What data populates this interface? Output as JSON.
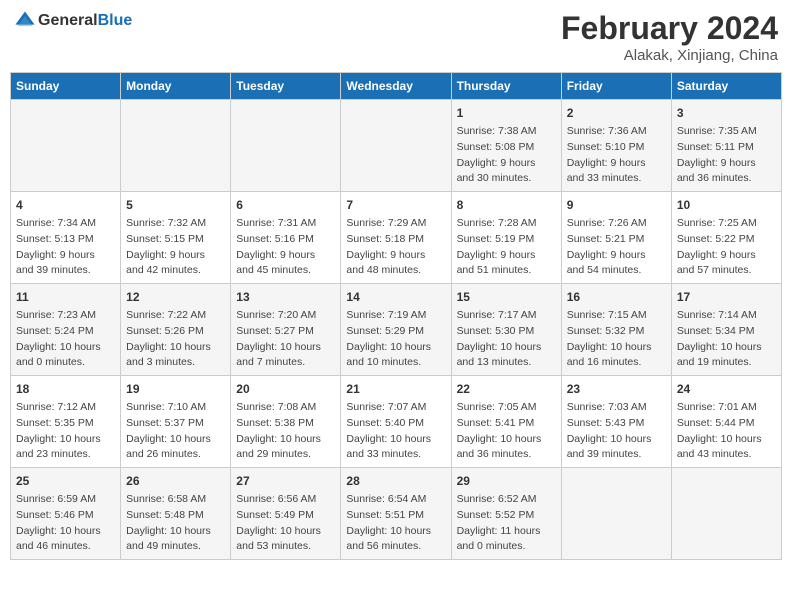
{
  "header": {
    "logo_line1": "General",
    "logo_line2": "Blue",
    "month_year": "February 2024",
    "location": "Alakak, Xinjiang, China"
  },
  "days_of_week": [
    "Sunday",
    "Monday",
    "Tuesday",
    "Wednesday",
    "Thursday",
    "Friday",
    "Saturday"
  ],
  "weeks": [
    [
      {
        "day": "",
        "info": ""
      },
      {
        "day": "",
        "info": ""
      },
      {
        "day": "",
        "info": ""
      },
      {
        "day": "",
        "info": ""
      },
      {
        "day": "1",
        "info": "Sunrise: 7:38 AM\nSunset: 5:08 PM\nDaylight: 9 hours\nand 30 minutes."
      },
      {
        "day": "2",
        "info": "Sunrise: 7:36 AM\nSunset: 5:10 PM\nDaylight: 9 hours\nand 33 minutes."
      },
      {
        "day": "3",
        "info": "Sunrise: 7:35 AM\nSunset: 5:11 PM\nDaylight: 9 hours\nand 36 minutes."
      }
    ],
    [
      {
        "day": "4",
        "info": "Sunrise: 7:34 AM\nSunset: 5:13 PM\nDaylight: 9 hours\nand 39 minutes."
      },
      {
        "day": "5",
        "info": "Sunrise: 7:32 AM\nSunset: 5:15 PM\nDaylight: 9 hours\nand 42 minutes."
      },
      {
        "day": "6",
        "info": "Sunrise: 7:31 AM\nSunset: 5:16 PM\nDaylight: 9 hours\nand 45 minutes."
      },
      {
        "day": "7",
        "info": "Sunrise: 7:29 AM\nSunset: 5:18 PM\nDaylight: 9 hours\nand 48 minutes."
      },
      {
        "day": "8",
        "info": "Sunrise: 7:28 AM\nSunset: 5:19 PM\nDaylight: 9 hours\nand 51 minutes."
      },
      {
        "day": "9",
        "info": "Sunrise: 7:26 AM\nSunset: 5:21 PM\nDaylight: 9 hours\nand 54 minutes."
      },
      {
        "day": "10",
        "info": "Sunrise: 7:25 AM\nSunset: 5:22 PM\nDaylight: 9 hours\nand 57 minutes."
      }
    ],
    [
      {
        "day": "11",
        "info": "Sunrise: 7:23 AM\nSunset: 5:24 PM\nDaylight: 10 hours\nand 0 minutes."
      },
      {
        "day": "12",
        "info": "Sunrise: 7:22 AM\nSunset: 5:26 PM\nDaylight: 10 hours\nand 3 minutes."
      },
      {
        "day": "13",
        "info": "Sunrise: 7:20 AM\nSunset: 5:27 PM\nDaylight: 10 hours\nand 7 minutes."
      },
      {
        "day": "14",
        "info": "Sunrise: 7:19 AM\nSunset: 5:29 PM\nDaylight: 10 hours\nand 10 minutes."
      },
      {
        "day": "15",
        "info": "Sunrise: 7:17 AM\nSunset: 5:30 PM\nDaylight: 10 hours\nand 13 minutes."
      },
      {
        "day": "16",
        "info": "Sunrise: 7:15 AM\nSunset: 5:32 PM\nDaylight: 10 hours\nand 16 minutes."
      },
      {
        "day": "17",
        "info": "Sunrise: 7:14 AM\nSunset: 5:34 PM\nDaylight: 10 hours\nand 19 minutes."
      }
    ],
    [
      {
        "day": "18",
        "info": "Sunrise: 7:12 AM\nSunset: 5:35 PM\nDaylight: 10 hours\nand 23 minutes."
      },
      {
        "day": "19",
        "info": "Sunrise: 7:10 AM\nSunset: 5:37 PM\nDaylight: 10 hours\nand 26 minutes."
      },
      {
        "day": "20",
        "info": "Sunrise: 7:08 AM\nSunset: 5:38 PM\nDaylight: 10 hours\nand 29 minutes."
      },
      {
        "day": "21",
        "info": "Sunrise: 7:07 AM\nSunset: 5:40 PM\nDaylight: 10 hours\nand 33 minutes."
      },
      {
        "day": "22",
        "info": "Sunrise: 7:05 AM\nSunset: 5:41 PM\nDaylight: 10 hours\nand 36 minutes."
      },
      {
        "day": "23",
        "info": "Sunrise: 7:03 AM\nSunset: 5:43 PM\nDaylight: 10 hours\nand 39 minutes."
      },
      {
        "day": "24",
        "info": "Sunrise: 7:01 AM\nSunset: 5:44 PM\nDaylight: 10 hours\nand 43 minutes."
      }
    ],
    [
      {
        "day": "25",
        "info": "Sunrise: 6:59 AM\nSunset: 5:46 PM\nDaylight: 10 hours\nand 46 minutes."
      },
      {
        "day": "26",
        "info": "Sunrise: 6:58 AM\nSunset: 5:48 PM\nDaylight: 10 hours\nand 49 minutes."
      },
      {
        "day": "27",
        "info": "Sunrise: 6:56 AM\nSunset: 5:49 PM\nDaylight: 10 hours\nand 53 minutes."
      },
      {
        "day": "28",
        "info": "Sunrise: 6:54 AM\nSunset: 5:51 PM\nDaylight: 10 hours\nand 56 minutes."
      },
      {
        "day": "29",
        "info": "Sunrise: 6:52 AM\nSunset: 5:52 PM\nDaylight: 11 hours\nand 0 minutes."
      },
      {
        "day": "",
        "info": ""
      },
      {
        "day": "",
        "info": ""
      }
    ]
  ]
}
